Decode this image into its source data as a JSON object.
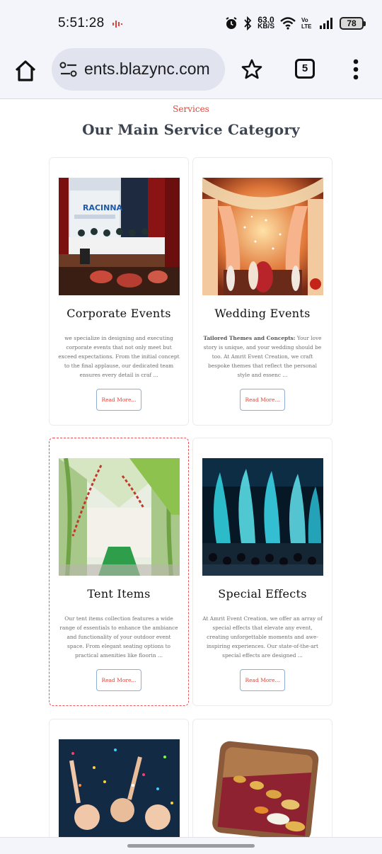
{
  "status_bar": {
    "time": "5:51:28",
    "net_speed_value": "63.0",
    "net_speed_unit": "KB/S",
    "volte_label": "Vo LTE",
    "battery_level": "78"
  },
  "browser": {
    "url": "ents.blazync.com",
    "tab_count": "5"
  },
  "section": {
    "eyebrow": "Services",
    "title": "Our Main Service Category"
  },
  "cards": [
    {
      "title": "Corporate Events",
      "desc_bold": "",
      "desc": "we specialize in designing and executing corporate events that not only meet but exceed expectations. From the initial concept to the final applause, our dedicated team ensures every detail is craf ...",
      "button": "Read More..."
    },
    {
      "title": "Wedding Events",
      "desc_bold": "Tailored Themes and Concepts:",
      "desc": " Your love story is unique, and your wedding should be too. At Amrit Event Creation, we craft bespoke themes that reflect the personal style and essenc ...",
      "button": "Read More..."
    },
    {
      "title": "Tent Items",
      "desc_bold": "",
      "desc": "Our tent items collection features a wide range of essentials to enhance the ambiance and functionality of your outdoor event space. From elegant seating options to practical amenities like floorin ...",
      "button": "Read More..."
    },
    {
      "title": "Special Effects",
      "desc_bold": "",
      "desc": "At Amrit Event Creation, we offer an array of special effects that elevate any event, creating unforgettable moments and awe-inspiring experiences. Our state-of-the-art special effects are designed ...",
      "button": "Read More..."
    }
  ],
  "card_images": {
    "corporate_banner": "RACINNA"
  },
  "colors": {
    "accent_red": "#e0453a",
    "title_gray": "#3d4450",
    "button_border": "#8fb0d6",
    "browser_chrome": "#f4f5fb",
    "url_pill": "#e1e3ef"
  }
}
